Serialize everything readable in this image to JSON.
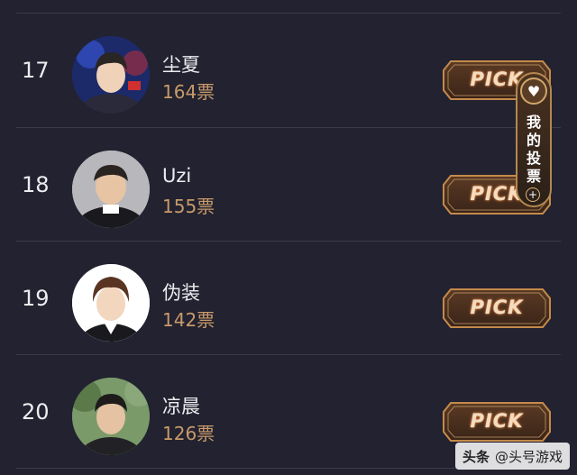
{
  "players": [
    {
      "rank": "17",
      "name": "尘夏",
      "votes": "164票",
      "pick_label": "PICK"
    },
    {
      "rank": "18",
      "name": "Uzi",
      "votes": "155票",
      "pick_label": "PICK"
    },
    {
      "rank": "19",
      "name": "伪装",
      "votes": "142票",
      "pick_label": "PICK"
    },
    {
      "rank": "20",
      "name": "凉晨",
      "votes": "126票",
      "pick_label": "PICK"
    }
  ],
  "my_votes": {
    "label": "我的投票",
    "icon": "heart-icon",
    "plus": "+"
  },
  "watermark": {
    "brand": "头条",
    "account": "@头号游戏"
  },
  "colors": {
    "background": "#222230",
    "vote_text": "#c89a6a",
    "pick_border": "#c48a4a",
    "divider": "#3a3a48"
  }
}
